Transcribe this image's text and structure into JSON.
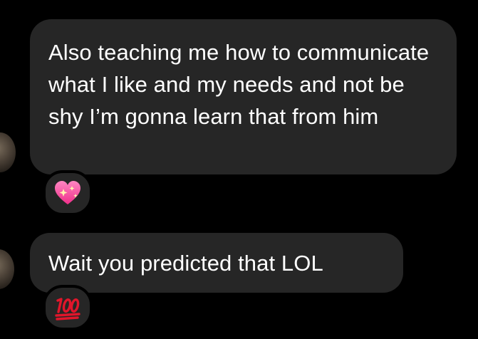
{
  "messages": [
    {
      "text": "Also teaching me how to communicate what I like and my needs and not be shy I’m gonna learn that from him",
      "reaction": "sparkling-heart"
    },
    {
      "text": "Wait you predicted that LOL",
      "reaction": "hundred-points"
    }
  ],
  "colors": {
    "background": "#000000",
    "bubble": "#262626",
    "text": "#ffffff",
    "heart": "#ff4fa3",
    "hundred": "#e0162b"
  }
}
